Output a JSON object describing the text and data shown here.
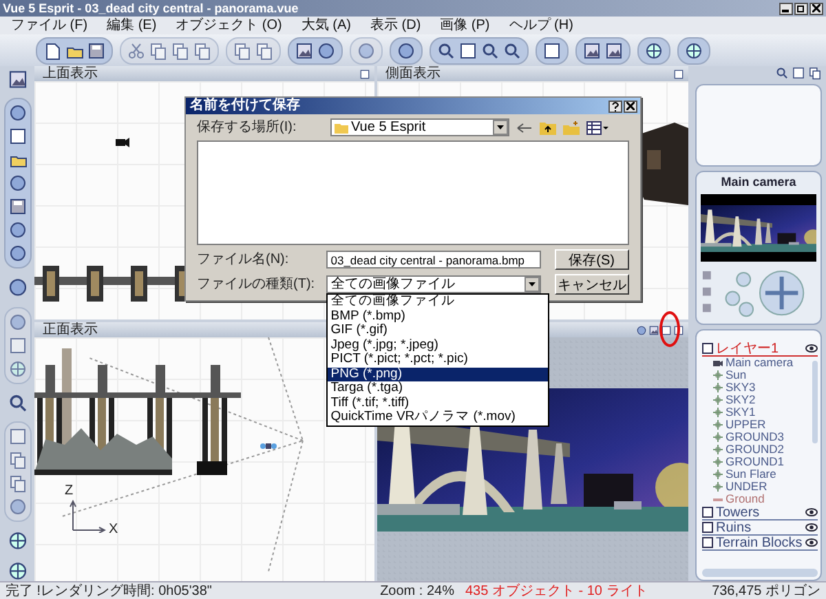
{
  "window": {
    "title": "Vue 5 Esprit - 03_dead city central - panorama.vue"
  },
  "menu": [
    "ファイル (F)",
    "編集 (E)",
    "オブジェクト (O)",
    "大気 (A)",
    "表示 (D)",
    "画像 (P)",
    "ヘルプ (H)"
  ],
  "top_view": {
    "title": "上面表示"
  },
  "side_view": {
    "title": "側面表示"
  },
  "front_view": {
    "title": "正面表示",
    "axis_labels": [
      "Z",
      "X"
    ]
  },
  "camera_panel": {
    "title": "Main camera"
  },
  "layers": [
    {
      "label": "レイヤー1",
      "selected": true,
      "children": [
        {
          "label": "Main camera",
          "kind": "camera"
        },
        {
          "label": "Sun",
          "kind": "light"
        },
        {
          "label": "SKY3",
          "kind": "light"
        },
        {
          "label": "SKY2",
          "kind": "light"
        },
        {
          "label": "SKY1",
          "kind": "light"
        },
        {
          "label": "UPPER",
          "kind": "light"
        },
        {
          "label": "GROUND3",
          "kind": "light"
        },
        {
          "label": "GROUND2",
          "kind": "light"
        },
        {
          "label": "GROUND1",
          "kind": "light"
        },
        {
          "label": "Sun Flare",
          "kind": "light"
        },
        {
          "label": "UNDER",
          "kind": "light"
        },
        {
          "label": "Ground",
          "kind": "ground"
        }
      ]
    },
    {
      "label": "Towers",
      "selected": false
    },
    {
      "label": "Ruins",
      "selected": false
    },
    {
      "label": "Terrain Blocks",
      "selected": false
    }
  ],
  "dialog": {
    "title": "名前を付けて保存",
    "location_label": "保存する場所(I):",
    "location": "Vue 5 Esprit",
    "filename_label": "ファイル名(N):",
    "filename": "03_dead city central - panorama.bmp",
    "type_label": "ファイルの種類(T):",
    "type": "全ての画像ファイル",
    "type_options": [
      {
        "label": "全ての画像ファイル",
        "selected": false
      },
      {
        "label": "BMP (*.bmp)",
        "selected": false
      },
      {
        "label": "GIF (*.gif)",
        "selected": false
      },
      {
        "label": "Jpeg (*.jpg; *.jpeg)",
        "selected": false
      },
      {
        "label": "PICT (*.pict; *.pct; *.pic)",
        "selected": false
      },
      {
        "label": "PNG (*.png)",
        "selected": true
      },
      {
        "label": "Targa (*.tga)",
        "selected": false
      },
      {
        "label": "Tiff (*.tif; *.tiff)",
        "selected": false
      },
      {
        "label": "QuickTime VRパノラマ (*.mov)",
        "selected": false
      }
    ],
    "save_button": "保存(S)",
    "cancel_button": "キャンセル"
  },
  "status_bar": {
    "status": "完了 !レンダリング時間: 0h05'38\"",
    "zoom": "Zoom : 24%",
    "objects": "435 オブジェクト - 10 ライト",
    "polygons": "736,475 ポリゴン"
  }
}
